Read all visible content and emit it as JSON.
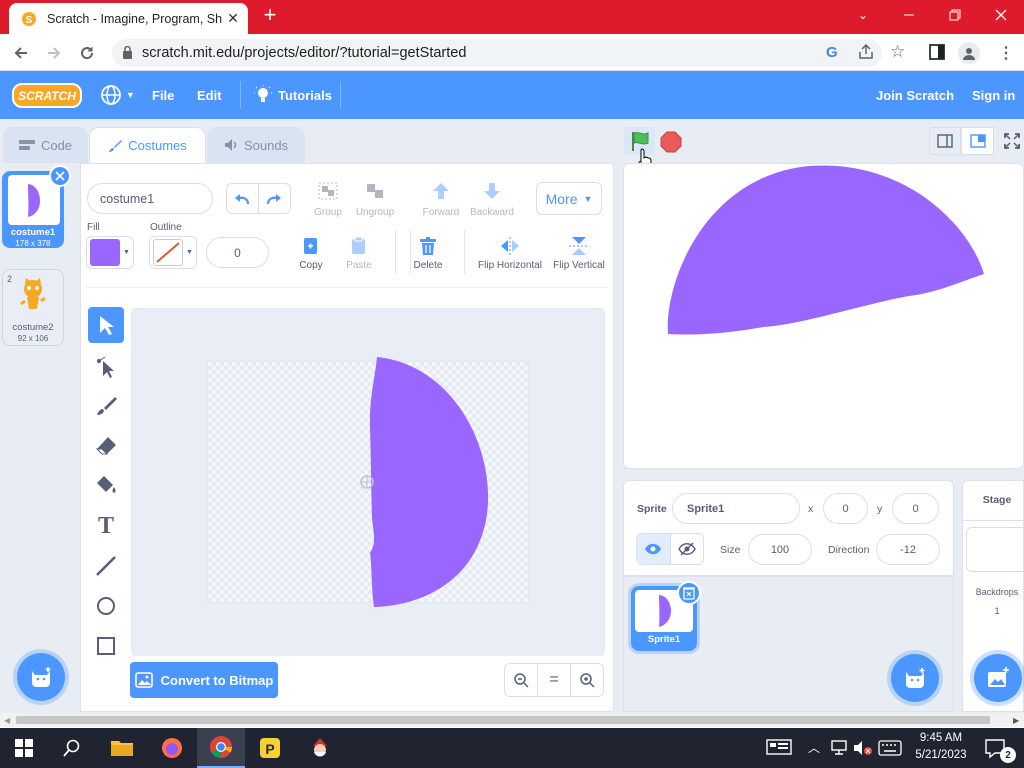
{
  "browser": {
    "tab_title": "Scratch - Imagine, Program, Shar",
    "url": "scratch.mit.edu/projects/editor/?tutorial=getStarted"
  },
  "menu": {
    "logo": "SCRATCH",
    "file": "File",
    "edit": "Edit",
    "tutorials": "Tutorials",
    "join": "Join Scratch",
    "signin": "Sign in"
  },
  "tabs": {
    "code": "Code",
    "costumes": "Costumes",
    "sounds": "Sounds"
  },
  "costumes": [
    {
      "num": "1",
      "name": "costume1",
      "size": "178 x 378"
    },
    {
      "num": "2",
      "name": "costume2",
      "size": "92 x 106"
    }
  ],
  "paint": {
    "costume_name": "costume1",
    "group": "Group",
    "ungroup": "Ungroup",
    "forward": "Forward",
    "backward": "Backward",
    "more": "More",
    "fill": "Fill",
    "outline": "Outline",
    "outline_width": "0",
    "copy": "Copy",
    "paste": "Paste",
    "delete": "Delete",
    "flip_h": "Flip Horizontal",
    "flip_v": "Flip Vertical",
    "convert": "Convert to Bitmap",
    "zoom_reset": "="
  },
  "sprite": {
    "label": "Sprite",
    "name": "Sprite1",
    "x_label": "x",
    "x": "0",
    "y_label": "y",
    "y": "0",
    "size_label": "Size",
    "size": "100",
    "direction_label": "Direction",
    "direction": "-12",
    "tile_name": "Sprite1"
  },
  "stage_panel": {
    "title": "Stage",
    "backdrops_label": "Backdrops",
    "backdrops_count": "1"
  },
  "taskbar": {
    "time": "9:45 AM",
    "date": "5/21/2023",
    "notif": "2"
  },
  "colors": {
    "accent": "#4c97ff",
    "purple": "#9966ff",
    "chrome_red": "#de1b2a",
    "go_green": "#4cbf56",
    "stop_red": "#ec5959"
  }
}
